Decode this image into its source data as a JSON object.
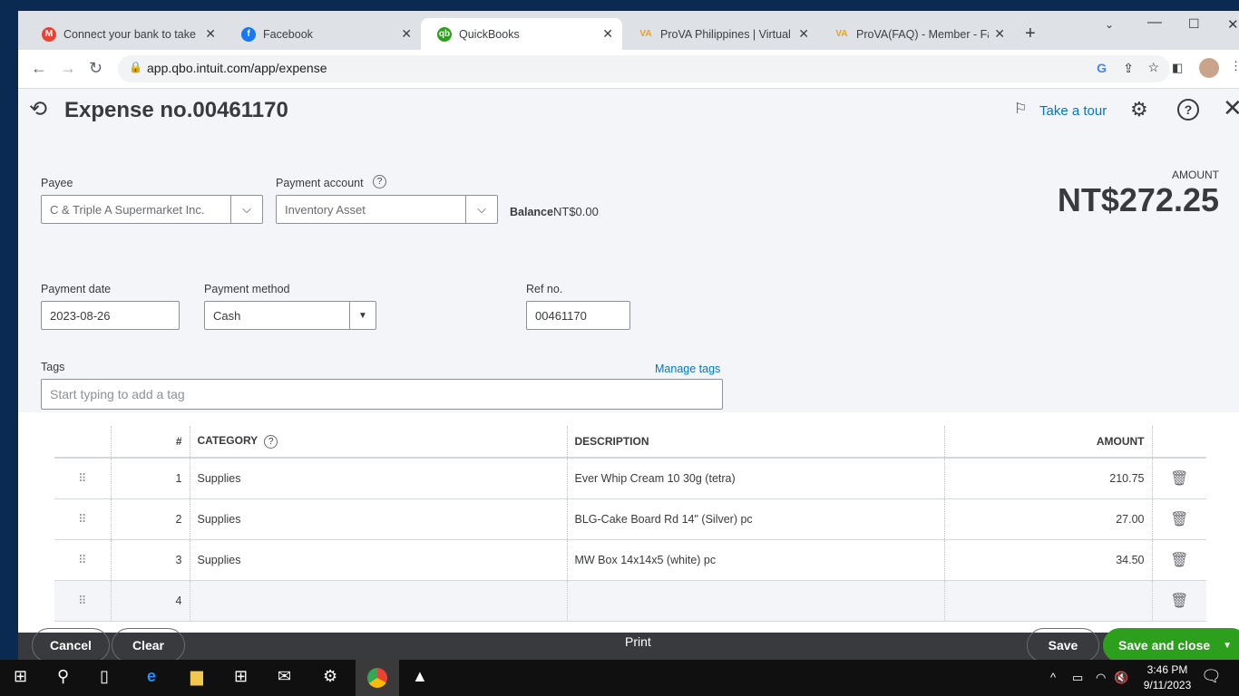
{
  "browser": {
    "tabs": [
      {
        "label": "Connect your bank to take co",
        "icon": "gmail-icon"
      },
      {
        "label": "Facebook",
        "icon": "facebook-icon"
      },
      {
        "label": "QuickBooks",
        "icon": "quickbooks-icon"
      },
      {
        "label": "ProVA Philippines | Virtual As",
        "icon": "prova-icon"
      },
      {
        "label": "ProVA(FAQ) - Member - Faq",
        "icon": "prova-icon"
      }
    ],
    "url": "app.qbo.intuit.com/app/expense"
  },
  "header": {
    "title": "Expense no.00461170",
    "tour": "Take a tour"
  },
  "form": {
    "payee_label": "Payee",
    "payee": "C & Triple A Supermarket Inc.",
    "account_label": "Payment account",
    "account": "Inventory Asset",
    "balance_label": "Balance",
    "balance": "NT$0.00",
    "amount_label": "AMOUNT",
    "amount": "NT$272.25",
    "date_label": "Payment date",
    "date": "2023-08-26",
    "method_label": "Payment method",
    "method": "Cash",
    "ref_label": "Ref no.",
    "ref": "00461170",
    "tags_label": "Tags",
    "manage_tags": "Manage tags",
    "tags_placeholder": "Start typing to add a tag"
  },
  "table": {
    "headers": [
      "#",
      "CATEGORY",
      "DESCRIPTION",
      "AMOUNT"
    ],
    "rows": [
      {
        "n": "1",
        "category": "Supplies",
        "description": "Ever Whip Cream 10 30g (tetra)",
        "amount": "210.75"
      },
      {
        "n": "2",
        "category": "Supplies",
        "description": "BLG-Cake Board Rd 14\" (Silver) pc",
        "amount": "27.00"
      },
      {
        "n": "3",
        "category": "Supplies",
        "description": "MW Box 14x14x5 (white) pc",
        "amount": "34.50"
      },
      {
        "n": "4",
        "category": "",
        "description": "",
        "amount": ""
      }
    ]
  },
  "footer": {
    "cancel": "Cancel",
    "clear": "Clear",
    "print": "Print",
    "save": "Save",
    "save_close": "Save and close"
  },
  "taskbar": {
    "time": "3:46 PM",
    "date": "9/11/2023"
  },
  "colors": {
    "green": "#2ca01c",
    "link": "#0077c5",
    "footer": "#393a3d"
  }
}
